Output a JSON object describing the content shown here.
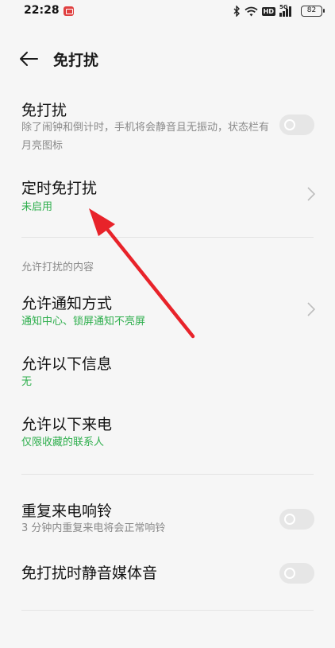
{
  "status_bar": {
    "time": "22:28",
    "hd_label": "HD",
    "network_label": "5G",
    "battery": "82"
  },
  "header": {
    "title": "免打扰"
  },
  "settings": {
    "dnd": {
      "title": "免打扰",
      "subtitle": "除了闹钟和倒计时，手机将会静音且无振动，状态栏有月亮图标",
      "enabled": false
    },
    "scheduled_dnd": {
      "title": "定时免打扰",
      "status": "未启用"
    },
    "section_allowed": "允许打扰的内容",
    "allow_notification_method": {
      "title": "允许通知方式",
      "status": "通知中心、锁屏通知不亮屏"
    },
    "allow_messages": {
      "title": "允许以下信息",
      "status": "无"
    },
    "allow_calls": {
      "title": "允许以下来电",
      "status": "仅限收藏的联系人"
    },
    "repeat_calls": {
      "title": "重复来电响铃",
      "subtitle": "3 分钟内重复来电将会正常响铃",
      "enabled": false
    },
    "mute_media": {
      "title": "免打扰时静音媒体音",
      "enabled": false
    }
  },
  "colors": {
    "accent_green": "#2dae4c",
    "annotation_red": "#e8232a",
    "background": "#f6f6f6"
  }
}
